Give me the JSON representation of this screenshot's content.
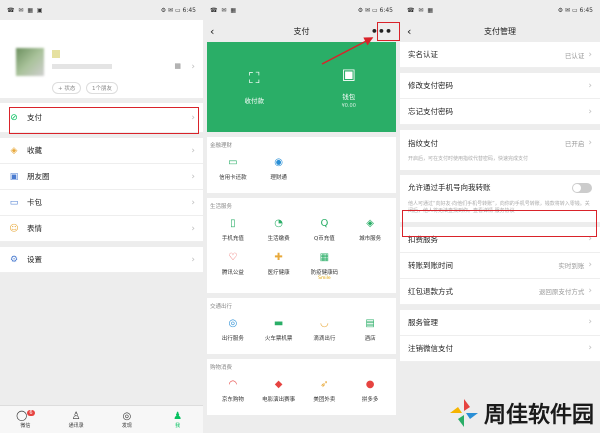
{
  "status": {
    "left": "☎ ✉ ▦ ▣",
    "right1": "⚙ ✉ ▭ 6:45",
    "right2": "⚙ ✉ ▭ 6:45",
    "right3": "⚙ ✉ ▭ 6:45"
  },
  "me": {
    "status_badge": "+ 状态",
    "friends_badge": "1个朋友",
    "menu": [
      {
        "label": "支付",
        "icon": "pay-icon"
      },
      {
        "label": "收藏",
        "icon": "favorites-icon"
      },
      {
        "label": "朋友圈",
        "icon": "moments-icon"
      },
      {
        "label": "卡包",
        "icon": "card-icon"
      },
      {
        "label": "表情",
        "icon": "emoji-icon"
      },
      {
        "label": "设置",
        "icon": "settings-icon"
      }
    ],
    "tabs": [
      {
        "label": "微信",
        "icon": "chat-icon",
        "badge": "6"
      },
      {
        "label": "通讯录",
        "icon": "contacts-icon"
      },
      {
        "label": "发现",
        "icon": "discover-icon"
      },
      {
        "label": "我",
        "icon": "me-icon"
      }
    ]
  },
  "pay": {
    "title": "支付",
    "more": "•••",
    "receive": "收付款",
    "wallet": "钱包",
    "wallet_sub": "¥0.00",
    "sections": [
      {
        "header": "金融理财",
        "items": [
          {
            "label": "信用卡还款",
            "icon": "▭"
          },
          {
            "label": "理财通",
            "icon": "◉"
          }
        ]
      },
      {
        "header": "生活服务",
        "items": [
          {
            "label": "手机充值",
            "icon": "▯"
          },
          {
            "label": "生活缴费",
            "icon": "◔"
          },
          {
            "label": "Q币充值",
            "icon": "Q"
          },
          {
            "label": "城市服务",
            "icon": "◈"
          },
          {
            "label": "腾讯公益",
            "icon": "♡"
          },
          {
            "label": "医疗健康",
            "icon": "✚"
          },
          {
            "label": "防疫健康码",
            "icon": "▦",
            "sub": "Smile"
          }
        ]
      },
      {
        "header": "交通出行",
        "items": [
          {
            "label": "出行服务",
            "icon": "◎"
          },
          {
            "label": "火车票机票",
            "icon": "▬"
          },
          {
            "label": "滴滴出行",
            "icon": "◡"
          },
          {
            "label": "酒店",
            "icon": "▤"
          }
        ]
      },
      {
        "header": "购物消费",
        "items": [
          {
            "label": "京东购物",
            "icon": "◠"
          },
          {
            "label": "电影演出赛事",
            "icon": "◆"
          },
          {
            "label": "美团外卖",
            "icon": "➶"
          },
          {
            "label": "拼多多",
            "icon": "●"
          }
        ]
      }
    ]
  },
  "manage": {
    "title": "支付管理",
    "rows1": [
      {
        "label": "实名认证",
        "value": "已认证"
      }
    ],
    "rows2": [
      {
        "label": "修改支付密码",
        "value": ""
      },
      {
        "label": "忘记支付密码",
        "value": ""
      }
    ],
    "rows3": [
      {
        "label": "指纹支付",
        "value": "已开启"
      }
    ],
    "fingerprint_desc": "开启后，可在支付时使用指纹代替密码，快速完成支付",
    "phone_toggle_label": "允许通过手机号向我转账",
    "phone_desc": "他人可通过“向好友·向他们手机号转账”，向你的手机号转账，钱款将转入零钱。关闭后，他人将无法查找到你。查看详情 服务协议",
    "rows4": [
      {
        "label": "扣费服务",
        "value": ""
      },
      {
        "label": "转账到账时间",
        "value": "实时到账"
      },
      {
        "label": "红包退款方式",
        "value": "退回原支付方式"
      }
    ],
    "rows5": [
      {
        "label": "服务管理",
        "value": ""
      },
      {
        "label": "注销微信支付",
        "value": ""
      }
    ]
  },
  "watermark": {
    "text": "周佳软件园"
  },
  "colors": {
    "accent": "#2aae67",
    "highlight": "#d9232a"
  }
}
